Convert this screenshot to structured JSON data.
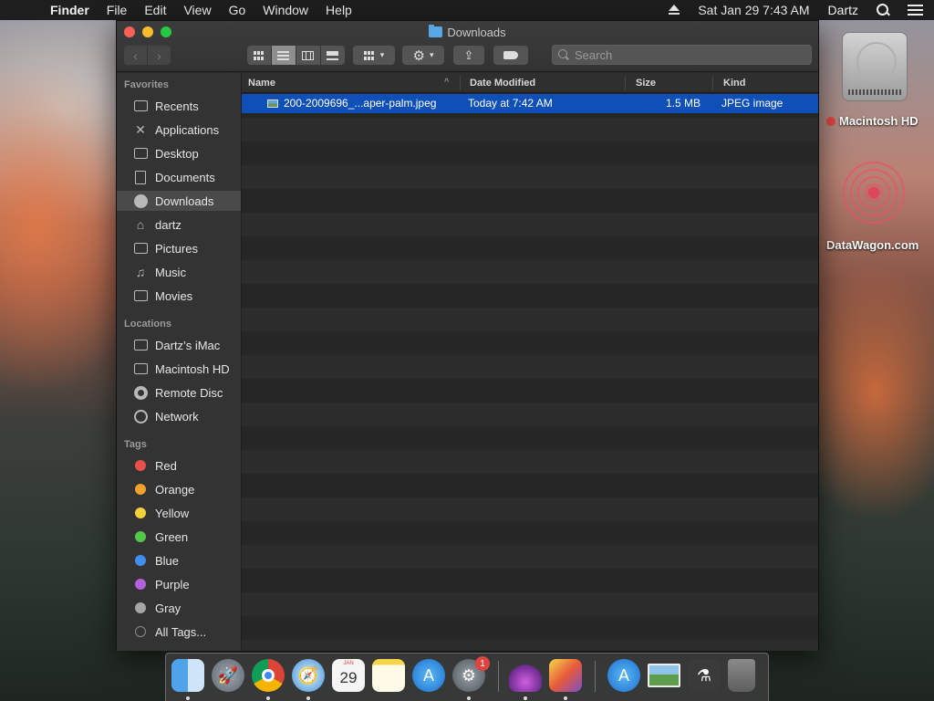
{
  "menubar": {
    "app_name": "Finder",
    "menus": [
      "File",
      "Edit",
      "View",
      "Go",
      "Window",
      "Help"
    ],
    "datetime": "Sat Jan 29  7:43 AM",
    "user": "Dartz"
  },
  "window": {
    "title": "Downloads",
    "search_placeholder": "Search"
  },
  "sidebar": {
    "favorites_heading": "Favorites",
    "favorites": [
      {
        "label": "Recents",
        "icon": "clock-icon"
      },
      {
        "label": "Applications",
        "icon": "applications-icon"
      },
      {
        "label": "Desktop",
        "icon": "desktop-icon"
      },
      {
        "label": "Documents",
        "icon": "documents-icon"
      },
      {
        "label": "Downloads",
        "icon": "downloads-icon",
        "selected": true
      },
      {
        "label": "dartz",
        "icon": "home-icon"
      },
      {
        "label": "Pictures",
        "icon": "camera-icon"
      },
      {
        "label": "Music",
        "icon": "music-note-icon"
      },
      {
        "label": "Movies",
        "icon": "film-icon"
      }
    ],
    "locations_heading": "Locations",
    "locations": [
      {
        "label": "Dartz’s iMac",
        "icon": "imac-icon"
      },
      {
        "label": "Macintosh HD",
        "icon": "hard-disk-icon"
      },
      {
        "label": "Remote Disc",
        "icon": "disc-icon"
      },
      {
        "label": "Network",
        "icon": "globe-icon"
      }
    ],
    "tags_heading": "Tags",
    "tags": [
      {
        "label": "Red",
        "color": "#e8514b"
      },
      {
        "label": "Orange",
        "color": "#f0a02d"
      },
      {
        "label": "Yellow",
        "color": "#f4d03a"
      },
      {
        "label": "Green",
        "color": "#52c848"
      },
      {
        "label": "Blue",
        "color": "#3f8ef0"
      },
      {
        "label": "Purple",
        "color": "#b45fdc"
      },
      {
        "label": "Gray",
        "color": "#a6a6a6"
      },
      {
        "label": "All Tags...",
        "color": "none"
      }
    ]
  },
  "columns": {
    "name": "Name",
    "date": "Date Modified",
    "size": "Size",
    "kind": "Kind"
  },
  "files": [
    {
      "name": "200-2009696_...aper-palm.jpeg",
      "date": "Today at 7:42 AM",
      "size": "1.5 MB",
      "kind": "JPEG image",
      "selected": true
    }
  ],
  "desktop": {
    "hd_label": "Macintosh HD",
    "dw_label": "DataWagon.com"
  },
  "dock": {
    "calendar_month": "JAN",
    "calendar_day": "29",
    "badge_count": "1"
  },
  "colors": {
    "selection": "#0f4fb8",
    "window_bg": "#262626"
  }
}
